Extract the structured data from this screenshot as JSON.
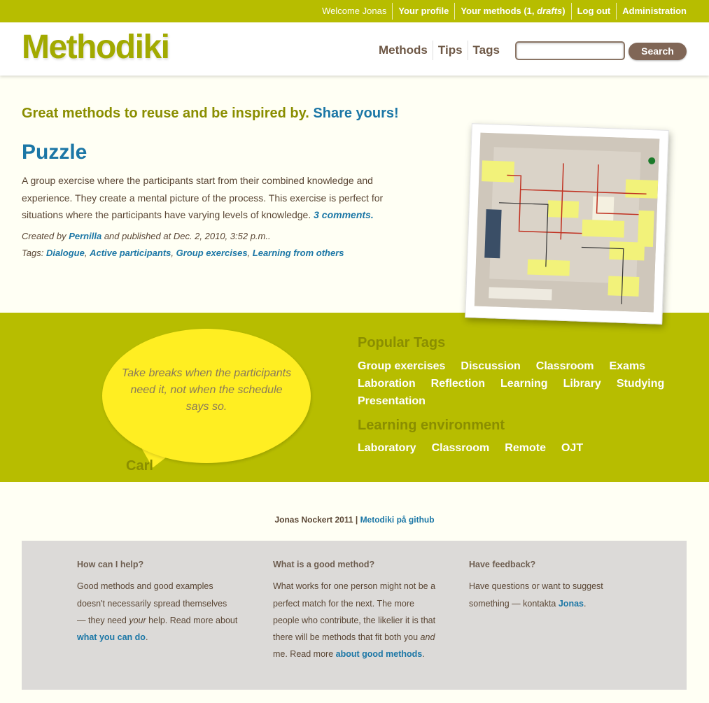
{
  "topnav": {
    "welcome": "Welcome Jonas",
    "profile": "Your profile",
    "methods_prefix": "Your methods (1, ",
    "methods_drafts": "drafts",
    "methods_suffix": ")",
    "logout": "Log out",
    "admin": "Administration"
  },
  "header": {
    "logo": "Methodiki",
    "nav": [
      "Methods",
      "Tips",
      "Tags"
    ],
    "search_value": "",
    "search_button": "Search"
  },
  "intro": {
    "tagline": "Great methods to reuse and be inspired by.",
    "share_link": "Share yours!"
  },
  "method": {
    "title": "Puzzle",
    "description": "A group exercise where the participants start from their combined knowledge and experience. They create a mental picture of the process. This exercise is perfect for situations where the participants have varying levels of knowledge.",
    "comments_link": "3 comments.",
    "created_by_prefix": "Created by",
    "author": "Pernilla",
    "published": "and published at Dec. 2, 2010, 3:52 p.m..",
    "tags_label": "Tags:",
    "tags": [
      "Dialogue",
      "Active participants",
      "Group exercises",
      "Learning from others"
    ]
  },
  "tip": {
    "quote": "Take breaks when the participants need it, not when the schedule says so.",
    "author": "Carl"
  },
  "popular_tags": {
    "heading": "Popular Tags",
    "tags": [
      "Group exercises",
      "Discussion",
      "Classroom",
      "Exams",
      "Laboration",
      "Reflection",
      "Learning",
      "Library",
      "Studying",
      "Presentation"
    ]
  },
  "learning_env": {
    "heading": "Learning environment",
    "tags": [
      "Laboratory",
      "Classroom",
      "Remote",
      "OJT"
    ]
  },
  "footer": {
    "credit": "Jonas Nockert 2011",
    "separator": "|",
    "github_link": "Metodiki på github",
    "columns": {
      "help": {
        "heading": "How can I help?",
        "text1": "Good methods and good examples doesn't necessarily spread themselves — they need ",
        "text_em": "your",
        "text2": " help. Read more about ",
        "link": "what you can do",
        "end": "."
      },
      "good_method": {
        "heading": "What is a good method?",
        "text1": "What works for one person might not be a perfect match for the next. The more people who contribute, the likelier it is that there will be methods that fit both you ",
        "text_em": "and",
        "text2": " me. Read more ",
        "link": "about good methods",
        "end": "."
      },
      "feedback": {
        "heading": "Have feedback?",
        "text1": "Have questions or want to suggest something — kontakta ",
        "link": "Jonas",
        "end": "."
      }
    }
  },
  "colors": {
    "accent_green": "#b7bd00",
    "link_blue": "#1c77a6",
    "bubble_yellow": "#ffee22",
    "brown": "#806656"
  }
}
